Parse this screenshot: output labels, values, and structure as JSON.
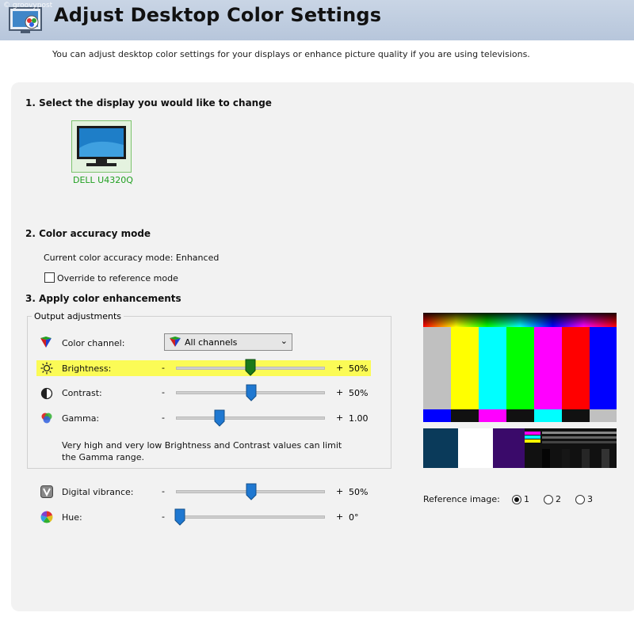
{
  "header": {
    "title": "Adjust Desktop Color Settings",
    "watermark": "© groovypost"
  },
  "description": "You can adjust desktop color settings for your displays or enhance picture quality if you are using televisions.",
  "section1": {
    "heading": "1. Select the display you would like to change",
    "display": {
      "label": "DELL U4320Q",
      "selected": true
    }
  },
  "section2": {
    "heading": "2. Color accuracy mode",
    "current_mode": "Current color accuracy mode: Enhanced",
    "override_label": "Override to reference mode",
    "override_checked": false
  },
  "section3": {
    "heading": "3. Apply color enhancements",
    "group_title": "Output adjustments",
    "color_channel": {
      "label": "Color channel:",
      "value": "All channels"
    },
    "brightness": {
      "label": "Brightness:",
      "minus": "-",
      "plus": "+",
      "value": "50%",
      "level": 0.5
    },
    "contrast": {
      "label": "Contrast:",
      "minus": "-",
      "plus": "+",
      "value": "50%",
      "level": 0.5
    },
    "gamma": {
      "label": "Gamma:",
      "minus": "-",
      "plus": "+",
      "value": "1.00",
      "level": 0.3
    },
    "note": "Very high and very low Brightness and Contrast values can limit the Gamma range.",
    "digital_vibrance": {
      "label": "Digital vibrance:",
      "minus": "-",
      "plus": "+",
      "value": "50%",
      "level": 0.5
    },
    "hue": {
      "label": "Hue:",
      "minus": "-",
      "plus": "+",
      "value": "0°",
      "level": 0.0
    }
  },
  "reference": {
    "label": "Reference image:",
    "options": [
      "1",
      "2",
      "3"
    ],
    "selected": "1"
  },
  "colors": {
    "highlight": "#fbfb56",
    "brightness_thumb": "#1a7a1a",
    "slider_thumb": "#1f78d1",
    "display_label": "#20a020"
  }
}
